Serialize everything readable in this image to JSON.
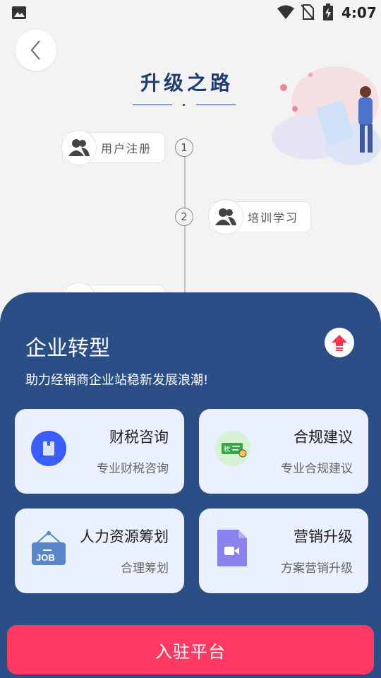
{
  "status_bar": {
    "time": "4:07",
    "icons": [
      "gallery-icon",
      "wifi-icon",
      "no-sim-icon",
      "battery-charging-icon"
    ]
  },
  "header": {
    "back_icon": "chevron-left-icon",
    "title": "升级之路"
  },
  "timeline": {
    "steps": [
      {
        "number": "1",
        "label": "用户注册",
        "icon": "users-icon"
      },
      {
        "number": "2",
        "label": "培训学习",
        "icon": "users-icon"
      }
    ]
  },
  "panel": {
    "title": "企业转型",
    "subtitle": "助力经销商企业站稳新发展浪潮!",
    "rocket_icon": "rocket-icon",
    "cards": [
      {
        "title": "财税咨询",
        "subtitle": "专业财税咨询",
        "icon": "finance-box-icon",
        "color": "#3b5cff"
      },
      {
        "title": "合规建议",
        "subtitle": "专业合规建议",
        "icon": "tax-card-icon",
        "color": "#4caf50"
      },
      {
        "title": "人力资源筹划",
        "subtitle": "合理筹划",
        "icon": "job-sign-icon",
        "color": "#5a86c8"
      },
      {
        "title": "营销升级",
        "subtitle": "方案营销升级",
        "icon": "video-file-icon",
        "color": "#8c82ef"
      }
    ]
  },
  "cta": {
    "label": "入驻平台",
    "color": "#ff3b63"
  },
  "colors": {
    "accent": "#1f3c74",
    "panel": "#2b4e86",
    "card": "#eaf0fd"
  }
}
